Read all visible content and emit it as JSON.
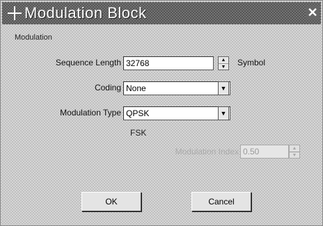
{
  "window": {
    "title": "Modulation Block",
    "close_glyph": "✕"
  },
  "group": {
    "label": "Modulation"
  },
  "sequence_length": {
    "label": "Sequence Length",
    "value": "32768",
    "unit": "Symbol"
  },
  "coding": {
    "label": "Coding",
    "value": "None"
  },
  "modulation_type": {
    "label": "Modulation Type",
    "value": "QPSK"
  },
  "fsk": {
    "label": "FSK"
  },
  "modulation_index": {
    "label": "Modulation Index",
    "value": "0.50"
  },
  "buttons": {
    "ok": "OK",
    "cancel": "Cancel"
  }
}
